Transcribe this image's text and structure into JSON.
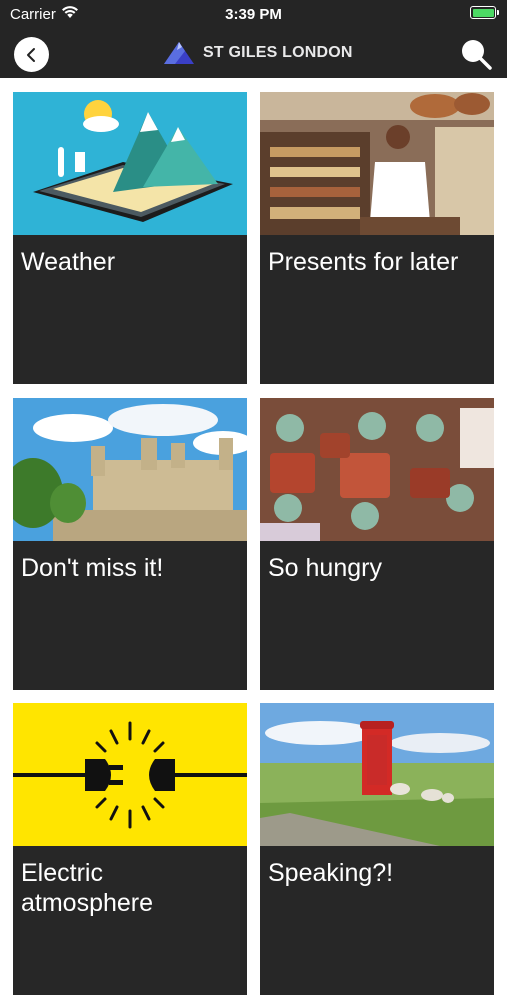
{
  "status": {
    "carrier": "Carrier",
    "time": "3:39 PM"
  },
  "header": {
    "logo_text": "ST GILES LONDON"
  },
  "cards": [
    {
      "title": "Weather"
    },
    {
      "title": "Presents for later"
    },
    {
      "title": "Don't miss it!"
    },
    {
      "title": "So hungry"
    },
    {
      "title": "Electric atmosphere"
    },
    {
      "title": "Speaking?!"
    }
  ]
}
